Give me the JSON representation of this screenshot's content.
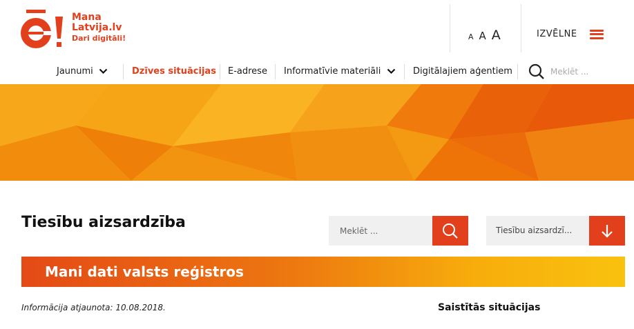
{
  "header": {
    "logo": {
      "line1": "Mana",
      "line2": "Latvija.lv",
      "tagline": "Dari digitāli!"
    },
    "font_size": [
      "A",
      "A",
      "A"
    ],
    "menu_label": "IZVĒLNE"
  },
  "nav": {
    "items": [
      {
        "label": "Jaunumi",
        "dropdown": true
      },
      {
        "label": "Dzīves situācijas",
        "active": true
      },
      {
        "label": "E-adrese"
      },
      {
        "label": "Informatīvie materiāli",
        "dropdown": true
      },
      {
        "label": "Digitālajiem aģentiem"
      }
    ],
    "search_placeholder": "Meklēt ..."
  },
  "page": {
    "title": "Tiesību aizsardzība",
    "search_placeholder": "Meklēt ...",
    "category_select": "Tiesību aizsardzī..."
  },
  "section": {
    "title": "Mani dati valsts reģistros",
    "updated": "Informācija atjaunota: 10.08.2018.",
    "related_heading": "Saistītās situācijas"
  },
  "colors": {
    "accent": "#e2401d",
    "banner_orange": "#f39a0f",
    "gradient_end": "#f9c20e"
  }
}
